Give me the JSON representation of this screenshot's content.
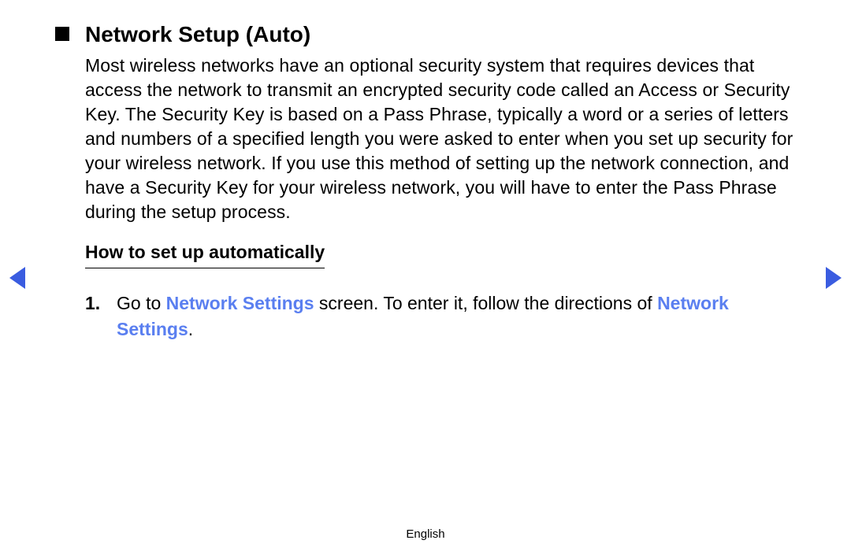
{
  "heading": "Network Setup (Auto)",
  "body": "Most wireless networks have an optional security system that requires devices that access the network to transmit an encrypted security code called an Access or Security Key. The Security Key is based on a Pass Phrase, typically a word or a series of letters and numbers of a specified length you were asked to enter when you set up security for your wireless network. If you use this method of setting up the network connection, and have a Security Key for your wireless network, you will have to enter the Pass Phrase during the setup process.",
  "subheading": "How to set up automatically",
  "step": {
    "number": "1.",
    "prefix": "Go to ",
    "link1": "Network Settings",
    "mid": " screen. To enter it, follow the directions of ",
    "link2": "Network Settings",
    "suffix": "."
  },
  "footer": "English"
}
